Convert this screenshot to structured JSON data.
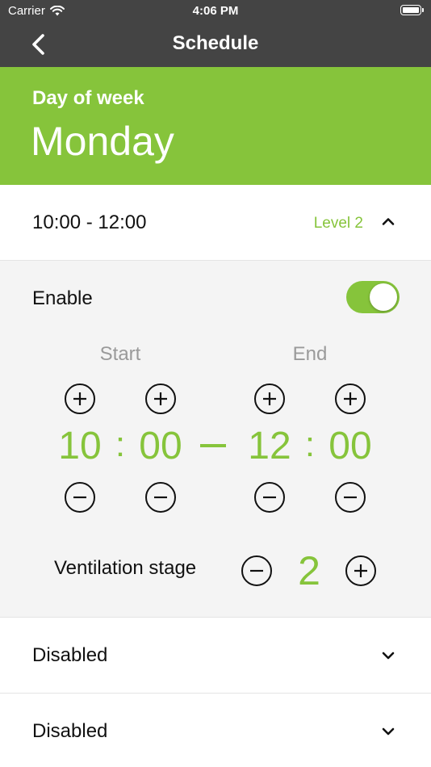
{
  "status_bar": {
    "carrier": "Carrier",
    "time": "4:06 PM"
  },
  "nav": {
    "title": "Schedule"
  },
  "header": {
    "label": "Day of week",
    "day": "Monday"
  },
  "schedule_rows": [
    {
      "time_range": "10:00 - 12:00",
      "level": "Level 2",
      "expanded": true
    },
    {
      "time_range": "Disabled",
      "expanded": false
    },
    {
      "time_range": "Disabled",
      "expanded": false
    }
  ],
  "detail": {
    "enable_label": "Enable",
    "enabled": true,
    "start_label": "Start",
    "end_label": "End",
    "start_hour": "10",
    "start_minute": "00",
    "end_hour": "12",
    "end_minute": "00",
    "time_separator": ":",
    "ventilation_label": "Ventilation stage",
    "ventilation_stage": "2"
  },
  "colors": {
    "accent": "#86c43b",
    "nav_bar": "#444444",
    "panel": "#f4f4f4"
  }
}
